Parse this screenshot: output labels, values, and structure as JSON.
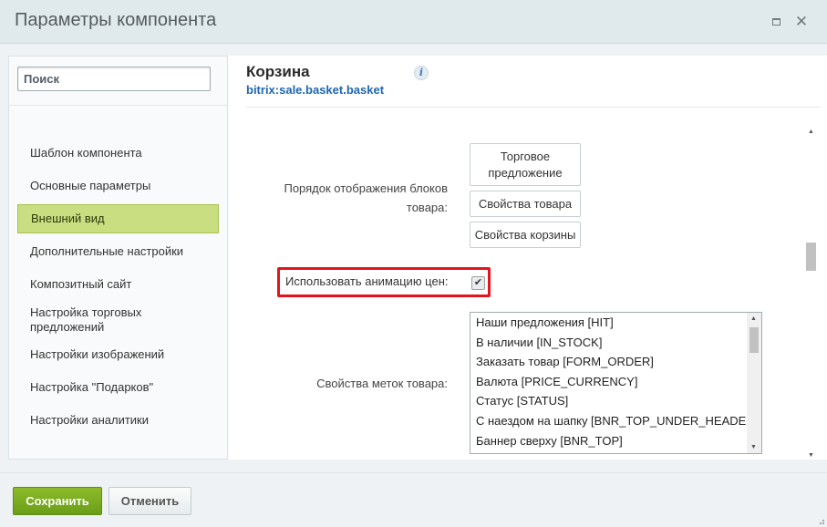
{
  "dialog": {
    "title": "Параметры компонента",
    "maximize_icon": "maximize-icon",
    "close_icon": "close-icon",
    "close_glyph": "✕"
  },
  "sidebar": {
    "search_placeholder": "Поиск",
    "items": [
      {
        "label": "Шаблон компонента"
      },
      {
        "label": "Основные параметры"
      },
      {
        "label": "Внешний вид",
        "active": true
      },
      {
        "label": "Дополнительные настройки"
      },
      {
        "label": "Композитный сайт"
      },
      {
        "label": "Настройка торговых предложений"
      },
      {
        "label": "Настройки изображений"
      },
      {
        "label": "Настройка \"Подарков\""
      },
      {
        "label": "Настройки аналитики"
      }
    ]
  },
  "component": {
    "title": "Корзина",
    "code": "bitrix:sale.basket.basket",
    "info_glyph": "i"
  },
  "params": {
    "block_order_label": "Порядок отображения блоков товара:",
    "block_order_options": [
      "Торговое предложение",
      "Свойства товара",
      "Свойства корзины"
    ],
    "price_animation_label": "Использовать анимацию цен:",
    "price_animation_checked": true,
    "price_animation_mark": "✔",
    "labels_label": "Свойства меток товара:",
    "labels_options": [
      "Наши предложения [HIT]",
      "В наличии [IN_STOCK]",
      "Заказать товар [FORM_ORDER]",
      "Валюта [PRICE_CURRENCY]",
      "Статус [STATUS]",
      "С наездом на шапку [BNR_TOP_UNDER_HEADER]",
      "Баннер сверху [BNR_TOP]"
    ]
  },
  "footer": {
    "save_label": "Сохранить",
    "cancel_label": "Отменить"
  },
  "colors": {
    "accent_green": "#6a9d18",
    "active_nav": "#c8de80",
    "highlight_red": "#e3141b",
    "link_blue": "#2067b0"
  }
}
